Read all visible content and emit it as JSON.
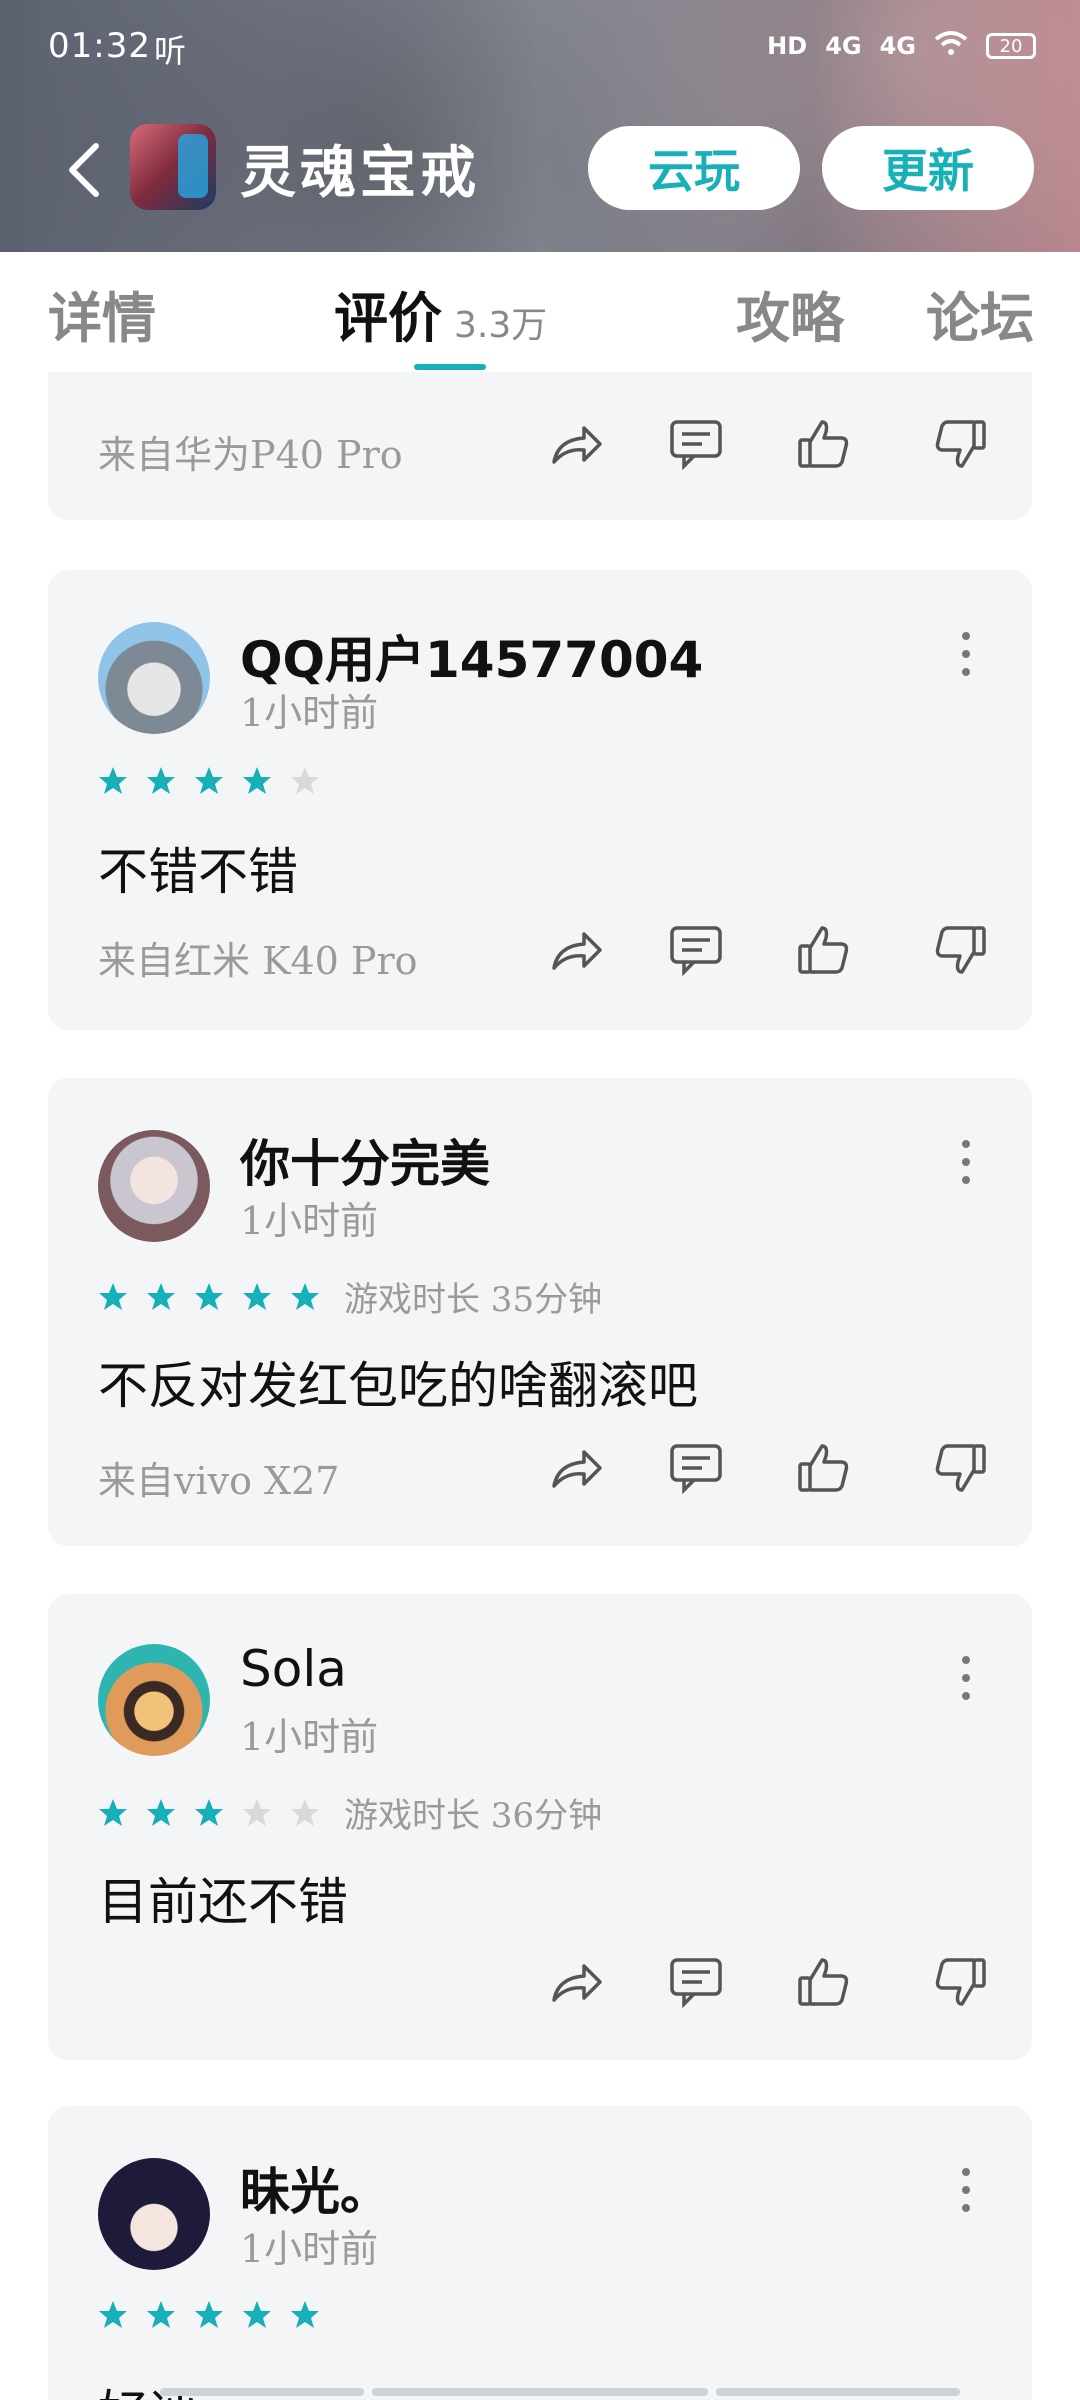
{
  "status_bar": {
    "time": "01:32",
    "sound_label": "听",
    "hd": "HD",
    "net1": "4G",
    "net2": "4G",
    "battery": "20"
  },
  "appbar": {
    "title": "灵魂宝戒",
    "cloud_play": "云玩",
    "update": "更新"
  },
  "tabs": {
    "details": "详情",
    "reviews": "评价",
    "reviews_count": "3.3万",
    "guides": "攻略",
    "forum": "论坛"
  },
  "reviews": [
    {
      "device": "来自华为P40 Pro"
    },
    {
      "user": "QQ用户14577004",
      "time": "1小时前",
      "rating": 4,
      "playtime": "",
      "content": "不错不错",
      "device": "来自红米 K40 Pro"
    },
    {
      "user": "你十分完美",
      "time": "1小时前",
      "rating": 5,
      "playtime": "游戏时长 35分钟",
      "content": "不反对发红包吃的啥翻滚吧",
      "device": "来自vivo X27"
    },
    {
      "user": "Sola",
      "time": "1小时前",
      "rating": 3,
      "playtime": "游戏时长 36分钟",
      "content": "目前还不错",
      "device": ""
    },
    {
      "user": "昧光。",
      "time": "1小时前",
      "rating": 5,
      "playtime": "",
      "content": "好评",
      "device": ""
    }
  ],
  "colors": {
    "accent": "#18b0b8",
    "star_empty": "#d9d9d9",
    "card_bg": "#f4f5f7"
  },
  "icons": [
    "back-arrow-icon",
    "share-icon",
    "comment-icon",
    "thumbs-up-icon",
    "thumbs-down-icon",
    "more-icon",
    "star-icon"
  ]
}
